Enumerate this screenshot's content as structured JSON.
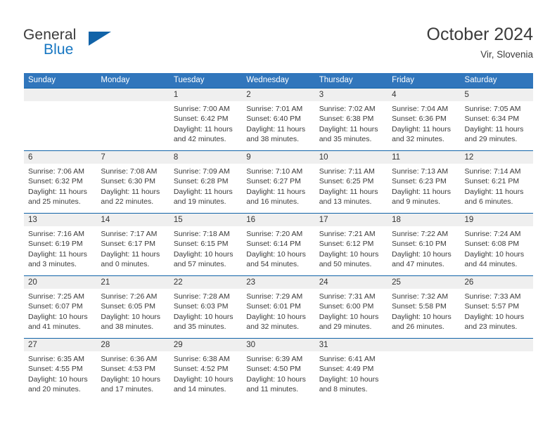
{
  "brand": {
    "word_general": "General",
    "word_blue": "Blue",
    "logo_icon": "triangle-icon",
    "accent_color": "#1163a8"
  },
  "header": {
    "month_title": "October 2024",
    "location": "Vir, Slovenia"
  },
  "calendar": {
    "header_bg": "#3176bc",
    "cell_band_bg": "#efefef",
    "cell_border_color": "#1163a8",
    "weekdays": [
      "Sunday",
      "Monday",
      "Tuesday",
      "Wednesday",
      "Thursday",
      "Friday",
      "Saturday"
    ],
    "weeks": [
      [
        {
          "day": "",
          "lines": []
        },
        {
          "day": "",
          "lines": []
        },
        {
          "day": "1",
          "lines": [
            "Sunrise: 7:00 AM",
            "Sunset: 6:42 PM",
            "Daylight: 11 hours",
            "and 42 minutes."
          ]
        },
        {
          "day": "2",
          "lines": [
            "Sunrise: 7:01 AM",
            "Sunset: 6:40 PM",
            "Daylight: 11 hours",
            "and 38 minutes."
          ]
        },
        {
          "day": "3",
          "lines": [
            "Sunrise: 7:02 AM",
            "Sunset: 6:38 PM",
            "Daylight: 11 hours",
            "and 35 minutes."
          ]
        },
        {
          "day": "4",
          "lines": [
            "Sunrise: 7:04 AM",
            "Sunset: 6:36 PM",
            "Daylight: 11 hours",
            "and 32 minutes."
          ]
        },
        {
          "day": "5",
          "lines": [
            "Sunrise: 7:05 AM",
            "Sunset: 6:34 PM",
            "Daylight: 11 hours",
            "and 29 minutes."
          ]
        }
      ],
      [
        {
          "day": "6",
          "lines": [
            "Sunrise: 7:06 AM",
            "Sunset: 6:32 PM",
            "Daylight: 11 hours",
            "and 25 minutes."
          ]
        },
        {
          "day": "7",
          "lines": [
            "Sunrise: 7:08 AM",
            "Sunset: 6:30 PM",
            "Daylight: 11 hours",
            "and 22 minutes."
          ]
        },
        {
          "day": "8",
          "lines": [
            "Sunrise: 7:09 AM",
            "Sunset: 6:28 PM",
            "Daylight: 11 hours",
            "and 19 minutes."
          ]
        },
        {
          "day": "9",
          "lines": [
            "Sunrise: 7:10 AM",
            "Sunset: 6:27 PM",
            "Daylight: 11 hours",
            "and 16 minutes."
          ]
        },
        {
          "day": "10",
          "lines": [
            "Sunrise: 7:11 AM",
            "Sunset: 6:25 PM",
            "Daylight: 11 hours",
            "and 13 minutes."
          ]
        },
        {
          "day": "11",
          "lines": [
            "Sunrise: 7:13 AM",
            "Sunset: 6:23 PM",
            "Daylight: 11 hours",
            "and 9 minutes."
          ]
        },
        {
          "day": "12",
          "lines": [
            "Sunrise: 7:14 AM",
            "Sunset: 6:21 PM",
            "Daylight: 11 hours",
            "and 6 minutes."
          ]
        }
      ],
      [
        {
          "day": "13",
          "lines": [
            "Sunrise: 7:16 AM",
            "Sunset: 6:19 PM",
            "Daylight: 11 hours",
            "and 3 minutes."
          ]
        },
        {
          "day": "14",
          "lines": [
            "Sunrise: 7:17 AM",
            "Sunset: 6:17 PM",
            "Daylight: 11 hours",
            "and 0 minutes."
          ]
        },
        {
          "day": "15",
          "lines": [
            "Sunrise: 7:18 AM",
            "Sunset: 6:15 PM",
            "Daylight: 10 hours",
            "and 57 minutes."
          ]
        },
        {
          "day": "16",
          "lines": [
            "Sunrise: 7:20 AM",
            "Sunset: 6:14 PM",
            "Daylight: 10 hours",
            "and 54 minutes."
          ]
        },
        {
          "day": "17",
          "lines": [
            "Sunrise: 7:21 AM",
            "Sunset: 6:12 PM",
            "Daylight: 10 hours",
            "and 50 minutes."
          ]
        },
        {
          "day": "18",
          "lines": [
            "Sunrise: 7:22 AM",
            "Sunset: 6:10 PM",
            "Daylight: 10 hours",
            "and 47 minutes."
          ]
        },
        {
          "day": "19",
          "lines": [
            "Sunrise: 7:24 AM",
            "Sunset: 6:08 PM",
            "Daylight: 10 hours",
            "and 44 minutes."
          ]
        }
      ],
      [
        {
          "day": "20",
          "lines": [
            "Sunrise: 7:25 AM",
            "Sunset: 6:07 PM",
            "Daylight: 10 hours",
            "and 41 minutes."
          ]
        },
        {
          "day": "21",
          "lines": [
            "Sunrise: 7:26 AM",
            "Sunset: 6:05 PM",
            "Daylight: 10 hours",
            "and 38 minutes."
          ]
        },
        {
          "day": "22",
          "lines": [
            "Sunrise: 7:28 AM",
            "Sunset: 6:03 PM",
            "Daylight: 10 hours",
            "and 35 minutes."
          ]
        },
        {
          "day": "23",
          "lines": [
            "Sunrise: 7:29 AM",
            "Sunset: 6:01 PM",
            "Daylight: 10 hours",
            "and 32 minutes."
          ]
        },
        {
          "day": "24",
          "lines": [
            "Sunrise: 7:31 AM",
            "Sunset: 6:00 PM",
            "Daylight: 10 hours",
            "and 29 minutes."
          ]
        },
        {
          "day": "25",
          "lines": [
            "Sunrise: 7:32 AM",
            "Sunset: 5:58 PM",
            "Daylight: 10 hours",
            "and 26 minutes."
          ]
        },
        {
          "day": "26",
          "lines": [
            "Sunrise: 7:33 AM",
            "Sunset: 5:57 PM",
            "Daylight: 10 hours",
            "and 23 minutes."
          ]
        }
      ],
      [
        {
          "day": "27",
          "lines": [
            "Sunrise: 6:35 AM",
            "Sunset: 4:55 PM",
            "Daylight: 10 hours",
            "and 20 minutes."
          ]
        },
        {
          "day": "28",
          "lines": [
            "Sunrise: 6:36 AM",
            "Sunset: 4:53 PM",
            "Daylight: 10 hours",
            "and 17 minutes."
          ]
        },
        {
          "day": "29",
          "lines": [
            "Sunrise: 6:38 AM",
            "Sunset: 4:52 PM",
            "Daylight: 10 hours",
            "and 14 minutes."
          ]
        },
        {
          "day": "30",
          "lines": [
            "Sunrise: 6:39 AM",
            "Sunset: 4:50 PM",
            "Daylight: 10 hours",
            "and 11 minutes."
          ]
        },
        {
          "day": "31",
          "lines": [
            "Sunrise: 6:41 AM",
            "Sunset: 4:49 PM",
            "Daylight: 10 hours",
            "and 8 minutes."
          ]
        },
        {
          "day": "",
          "lines": []
        },
        {
          "day": "",
          "lines": []
        }
      ]
    ]
  }
}
